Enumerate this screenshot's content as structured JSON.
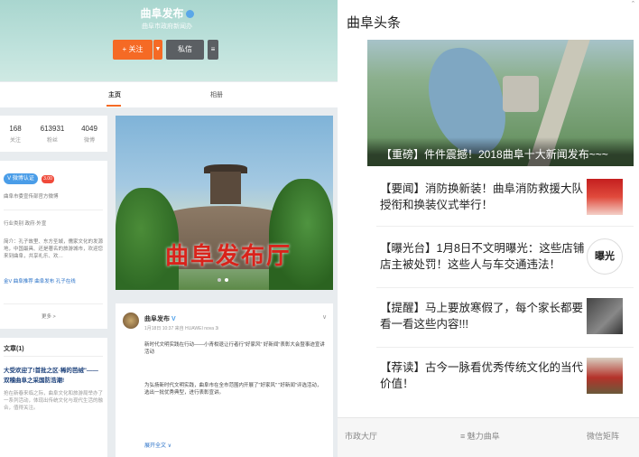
{
  "profile": {
    "name": "曲阜发布",
    "subtitle": "曲阜市政府新闻办",
    "follow_label": "+ 关注",
    "message_label": "私信",
    "more_label": "≡"
  },
  "tabs": [
    {
      "label": "主页"
    },
    {
      "label": "相册"
    }
  ],
  "stats": [
    {
      "value": "168",
      "label": "关注"
    },
    {
      "value": "613931",
      "label": "粉丝"
    },
    {
      "value": "4049",
      "label": "微博"
    }
  ],
  "info": {
    "badge": "V 微博认证",
    "badge_count": "3.00",
    "verify_text": "曲阜市委宣传部官方微博",
    "industry": "行业类别 政府·外宣",
    "intro": "简介：孔子故里、东方圣城，儒家文化的发源地，中国最具、还是著名的旅游城市，欢迎您来到曲阜，共享礼乐、欢…",
    "links": "金V 曲阜推荐 曲阜发布 孔子在线",
    "more_label": "更多 >"
  },
  "articles": {
    "header": "文章(1)",
    "title": "大受欢迎了!首批之区·稀的芭绒\"——双稽曲阜之采国防浩潮!",
    "body": "抢在新春来临之际，曲阜文化和旅游局举办了一系列活动，体现出传统文化与现代生活的融合，值得关注。"
  },
  "post": {
    "author": "曲阜发布",
    "meta": "1月18日 10:37 来自 HUAWEI nova 3i",
    "line1": "新时代文明实践在行动——小青柑退让行者行\"好家风\" 好新闻\"表彰大会暨事迹宣讲活动",
    "line2": "为弘扬新时代文明实践，曲阜市在全市范围内开展了\"好家风\" \"好新闻\"评选活动，选出一批优秀典型，进行表彰宣讲。",
    "expand": "展开全文 ∨"
  },
  "banner": {
    "title": "曲阜发布厅"
  },
  "news": {
    "title": "曲阜头条",
    "hero": "【重磅】件件震撼！2018曲阜十大新闻发布~~~",
    "items": [
      {
        "text": "【要闻】消防换新装！曲阜消防救援大队授衔和换装仪式举行！"
      },
      {
        "text": "【曝光台】1月8日不文明曝光：这些店铺店主被处罚！这些人与车交通违法！"
      },
      {
        "text": "【提醒】马上要放寒假了，每个家长都要看一看这些内容!!!"
      },
      {
        "text": "【荐读】古今一脉看优秀传统文化的当代价值！"
      }
    ],
    "thumb2_label": "曝光"
  },
  "footer": [
    {
      "label": "市政大厅"
    },
    {
      "label": "≡ 魅力曲阜"
    },
    {
      "label": "微信矩阵"
    }
  ],
  "colors": {
    "accent": "#f56a25",
    "cover": "#bfe2dc",
    "link": "#2a72c8"
  }
}
